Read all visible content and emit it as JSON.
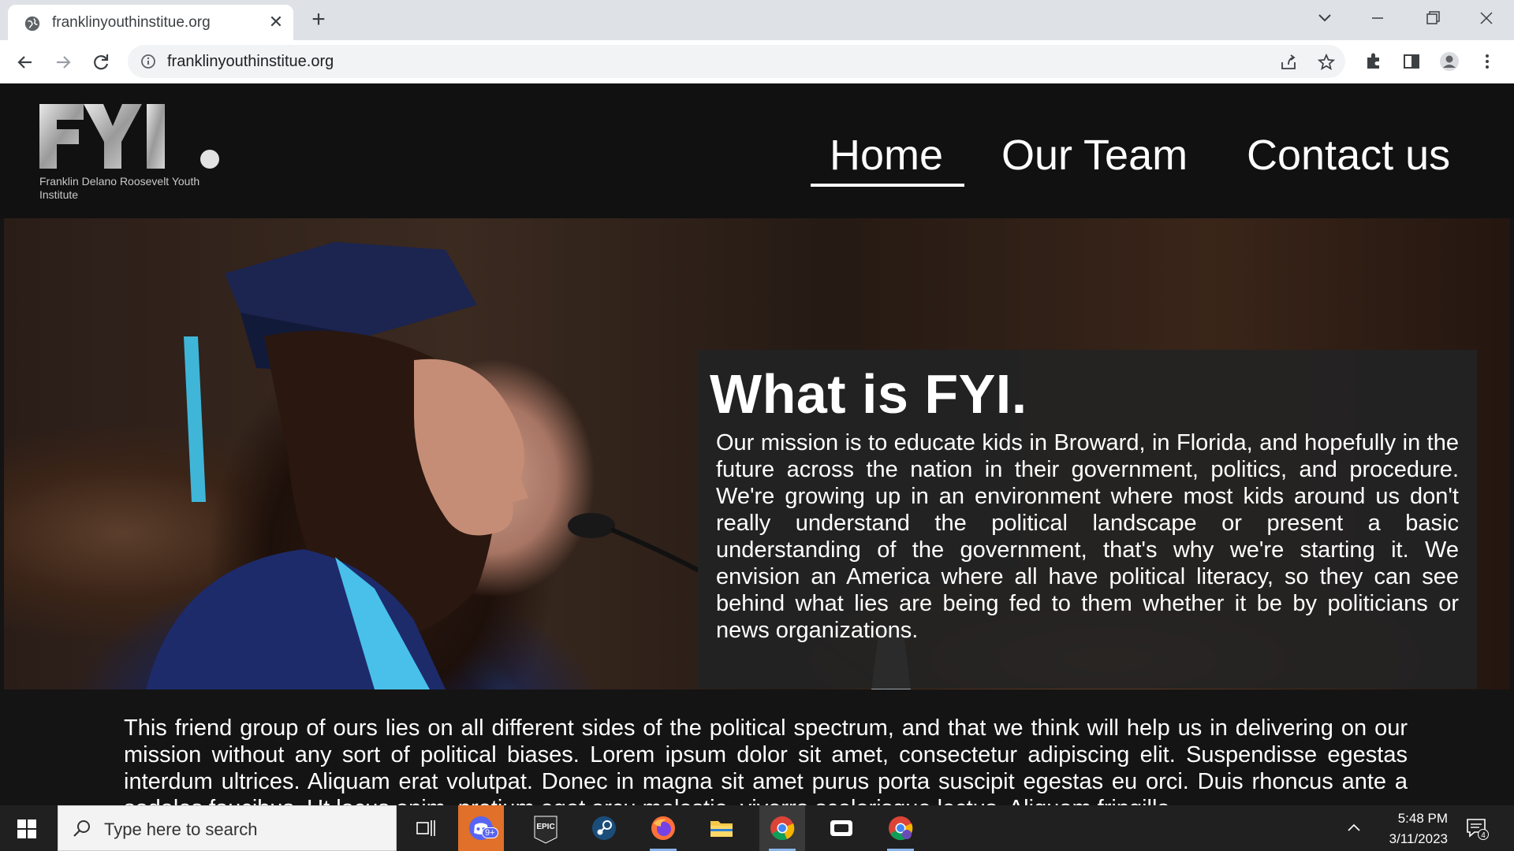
{
  "browser": {
    "tab_title": "franklinyouthinstitue.org",
    "url": "franklinyouthinstitue.org"
  },
  "site": {
    "logo_text": "FYI.",
    "logo_subtitle": "Franklin Delano Roosevelt Youth Institute",
    "nav": {
      "home": "Home",
      "team": "Our Team",
      "contact": "Contact us"
    },
    "hero": {
      "title": "What is FYI.",
      "text": "Our mission is to educate kids in Broward, in Florida, and hopefully in the future across the nation in their government, politics, and procedure. We're growing up in an environment where most kids around us don't really understand the political landscape or present a basic understanding of the government, that's why we're starting it. We envision an America where all have political literacy, so they can see behind what lies are being fed to them whether it be by politicians or news organizations."
    },
    "about_text": "This friend group of ours lies on all different sides of the political spectrum, and that we think will help us in delivering on our mission without any sort of political biases. Lorem ipsum dolor sit amet, consectetur adipiscing elit. Suspendisse egestas interdum ultrices. Aliquam erat volutpat. Donec in magna sit amet purus porta suscipit egestas eu orci. Duis rhoncus ante a sodales faucibus. Ut lacus enim, pretium eget arcu molestie, viverra scelerisque lectus. Aliquam fringilla"
  },
  "taskbar": {
    "search_placeholder": "Type here to search",
    "time": "5:48 PM",
    "date": "3/11/2023",
    "discord_badge": "9+",
    "notification_count": "4",
    "epic_label": "EPIC"
  },
  "colors": {
    "site_bg": "#141414",
    "header_bg": "#111111",
    "card_bg": "#232323",
    "taskbar_bg": "#202020"
  }
}
